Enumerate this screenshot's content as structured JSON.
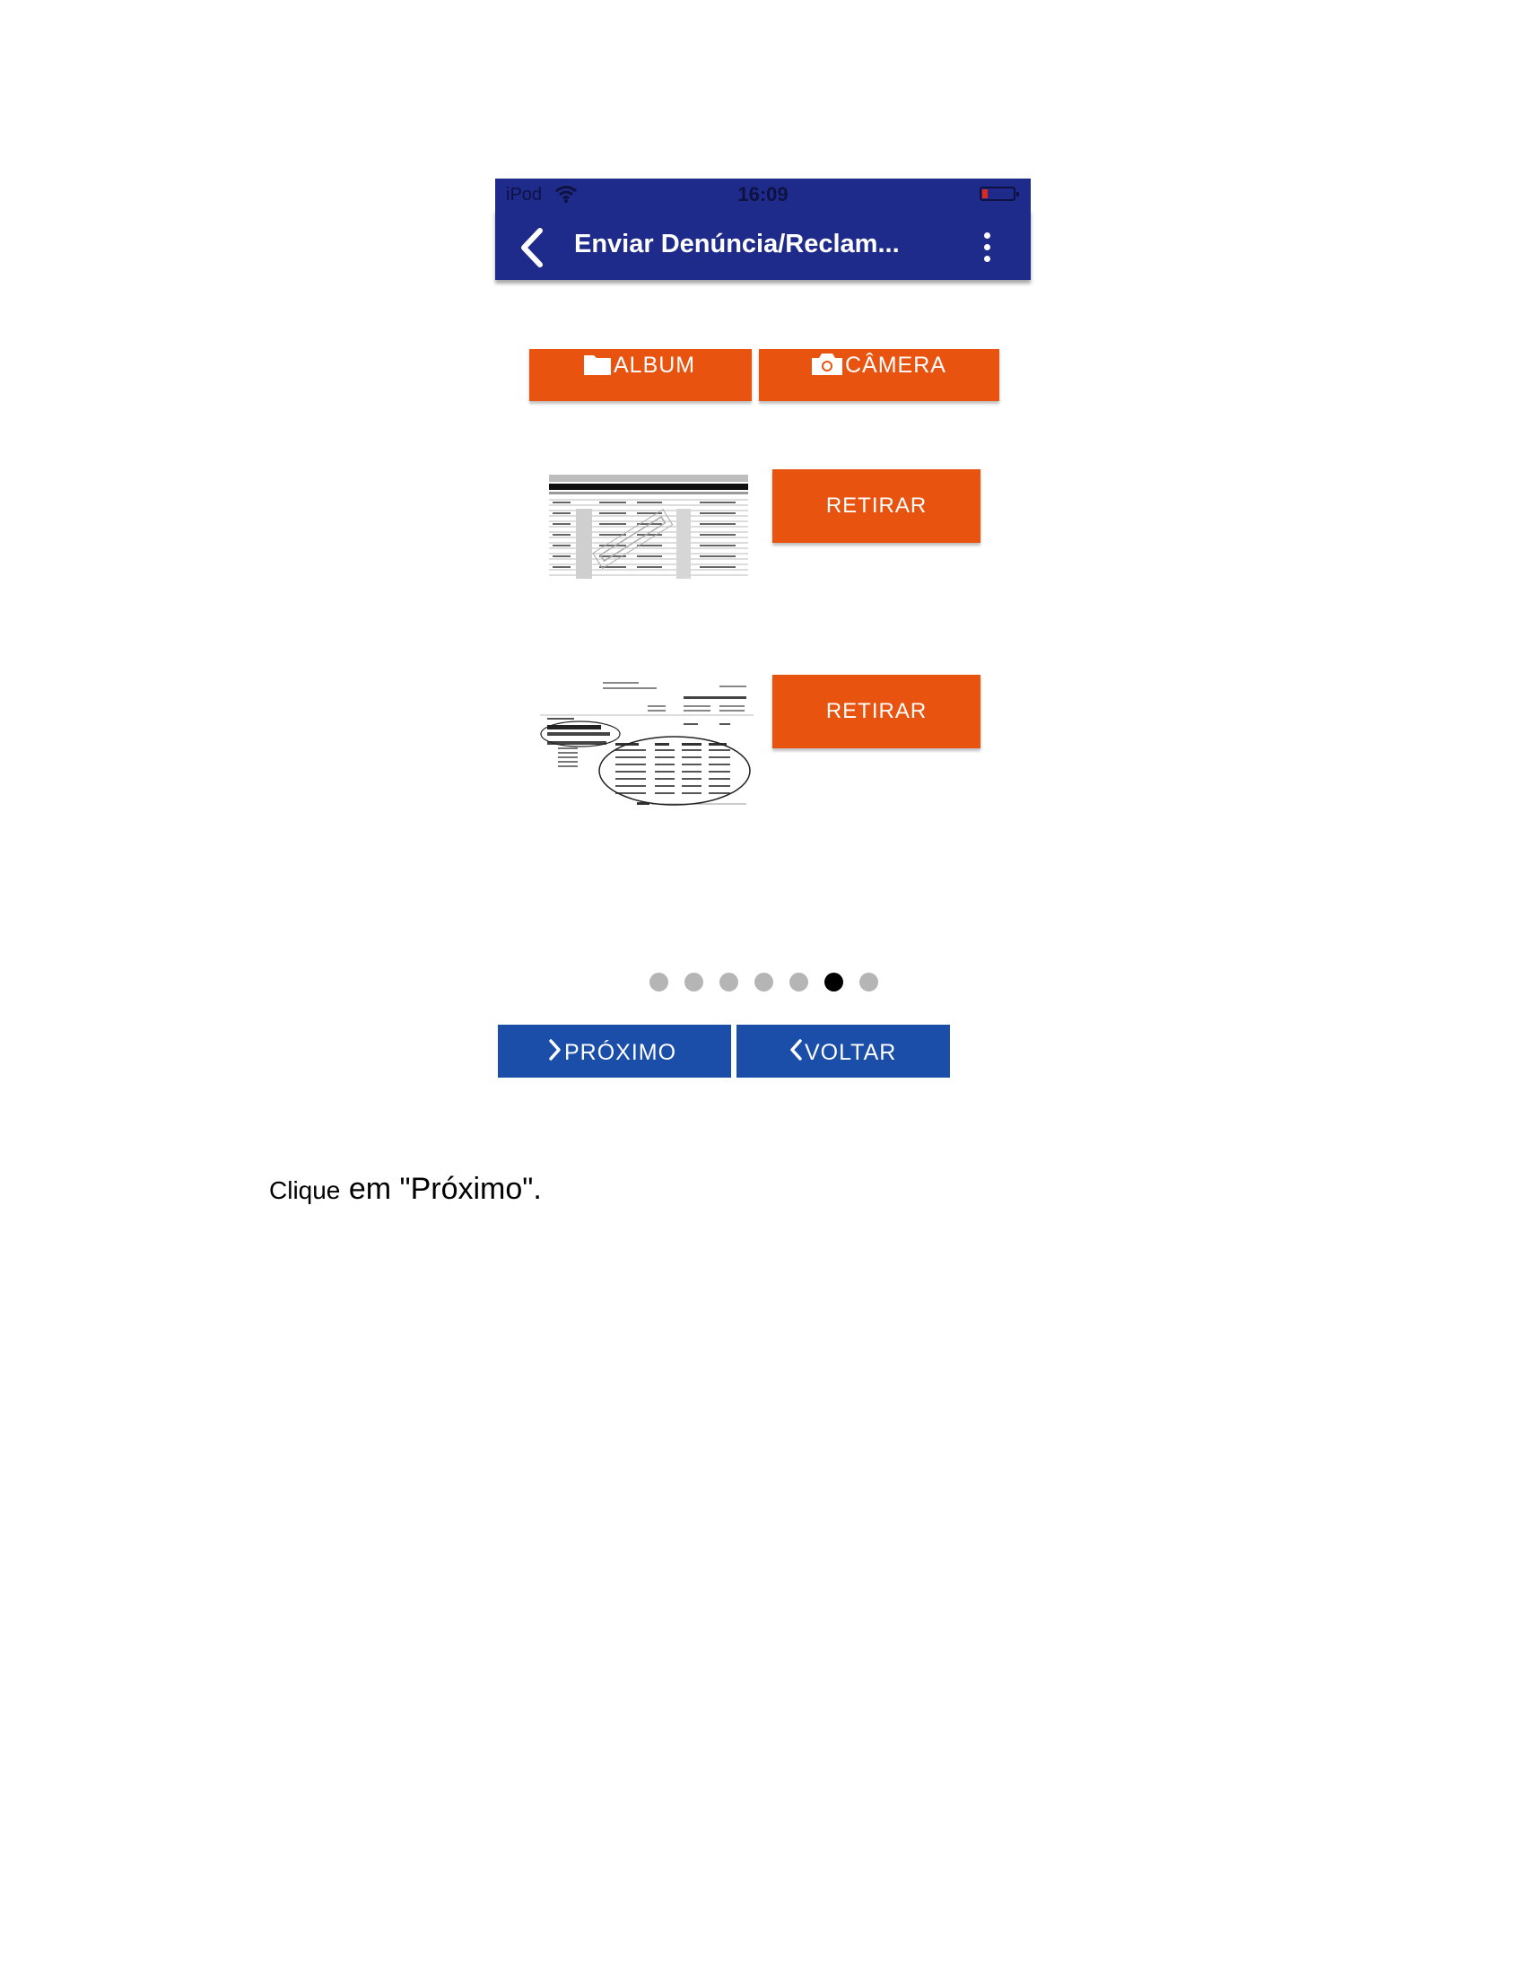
{
  "status_bar": {
    "carrier": "iPod",
    "time": "16:09"
  },
  "app_bar": {
    "title": "Enviar Denúncia/Reclam..."
  },
  "media_buttons": {
    "album_label": "ALBUM",
    "camera_label": "CÂMERA"
  },
  "attachments": [
    {
      "remove_label": "RETIRAR",
      "thumbnail": "invoice-table-exemplo"
    },
    {
      "remove_label": "RETIRAR",
      "thumbnail": "invoice-call-detail"
    }
  ],
  "pager": {
    "total": 7,
    "active_index": 5
  },
  "nav": {
    "next_label": "PRÓXIMO",
    "back_label": "VOLTAR"
  },
  "caption": {
    "part1": "Clique",
    "part2": " em \"Próximo\"."
  },
  "colors": {
    "app_bar": "#1f2b8a",
    "orange": "#e8540f",
    "blue_button": "#1b4ea8"
  }
}
